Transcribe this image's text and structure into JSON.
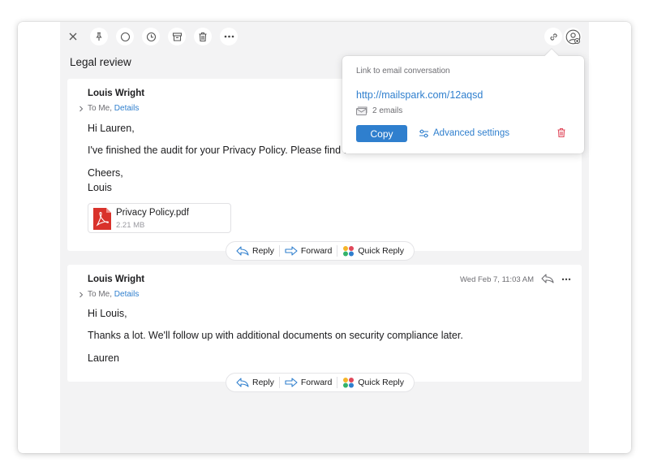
{
  "toolbar": {
    "icons": [
      "close-icon",
      "pin-icon",
      "circle-icon",
      "clock-icon",
      "archive-icon",
      "trash-icon",
      "more-icon",
      "link-icon",
      "share-user-icon"
    ]
  },
  "thread": {
    "subject": "Legal review"
  },
  "messages": [
    {
      "sender": "Louis Wright",
      "to": "To Me,",
      "details": "Details",
      "lines": [
        "Hi Lauren,",
        "I've finished the audit for your Privacy Policy. Please find the",
        "Cheers,",
        "Louis"
      ],
      "attachment": {
        "name": "Privacy Policy.pdf",
        "size": "2.21 MB"
      }
    },
    {
      "sender": "Louis Wright",
      "to": "To Me,",
      "details": "Details",
      "date": "Wed Feb 7, 11:03 AM",
      "lines": [
        "Hi Louis,",
        "Thanks a lot. We'll follow up with additional documents on security compliance later.",
        "Lauren"
      ]
    }
  ],
  "actions": {
    "reply": "Reply",
    "forward": "Forward",
    "quick_reply": "Quick Reply"
  },
  "popover": {
    "title": "Link to email conversation",
    "link": "http://mailspark.com/12aqsd",
    "count": "2 emails",
    "copy": "Copy",
    "advanced": "Advanced settings"
  },
  "colors": {
    "accent": "#2f7fce",
    "danger": "#e0485a",
    "pane_bg": "#f3f3f4"
  }
}
